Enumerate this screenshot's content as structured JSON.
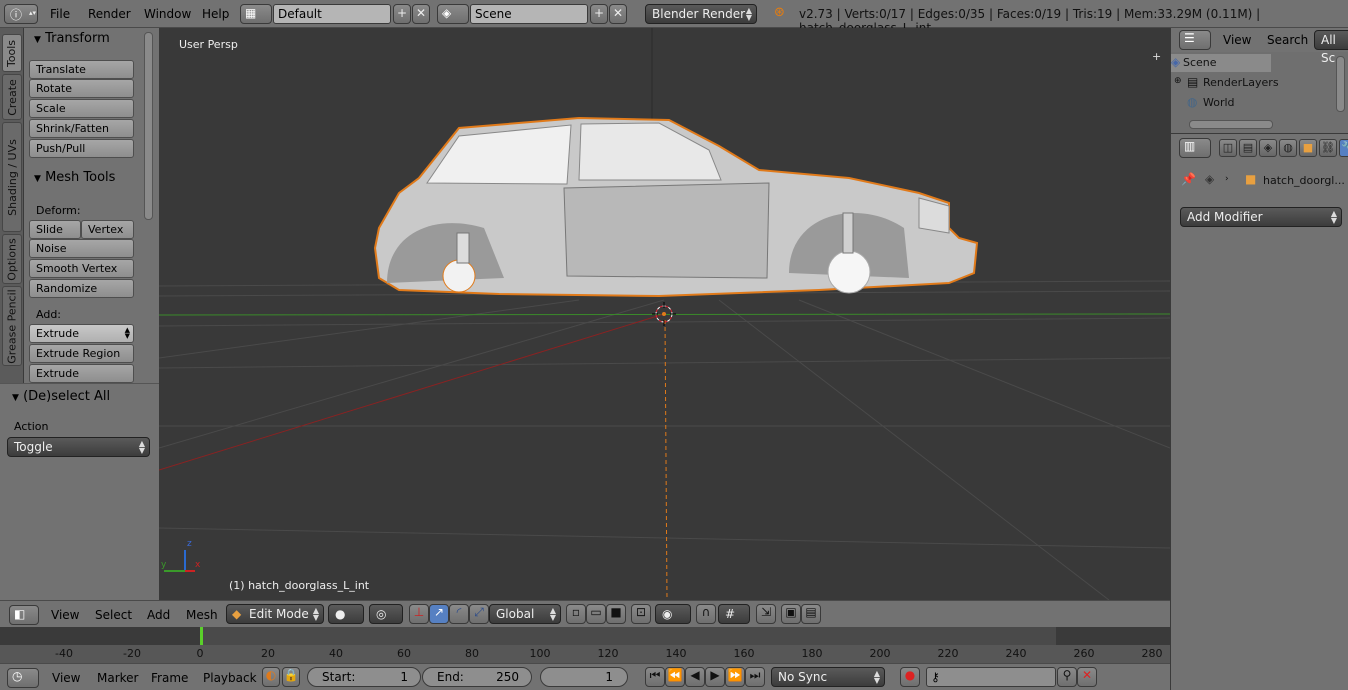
{
  "topbar": {
    "menus": [
      "File",
      "Render",
      "Window",
      "Help"
    ],
    "layout": "Default",
    "scene": "Scene",
    "engine": "Blender Render",
    "stats": "v2.73 | Verts:0/17 | Edges:0/35 | Faces:0/19 | Tris:19 | Mem:33.29M (0.11M) | hatch_doorglass_L_int"
  },
  "toolshelf": {
    "tabs": [
      "Tools",
      "Create",
      "Shading / UVs",
      "Options",
      "Grease Pencil"
    ],
    "transform_title": "Transform",
    "transform_buttons": [
      "Translate",
      "Rotate",
      "Scale",
      "Shrink/Fatten",
      "Push/Pull"
    ],
    "mesh_title": "Mesh Tools",
    "deform_label": "Deform:",
    "slide_edge": "Slide Ed",
    "vertex": "Vertex",
    "noise": "Noise",
    "smooth_vertex": "Smooth Vertex",
    "randomize": "Randomize",
    "add_label": "Add:",
    "extrude": "Extrude",
    "extrude_region": "Extrude Region",
    "extrude_individual": "Extrude Individual"
  },
  "operator": {
    "title": "(De)select All",
    "action_label": "Action",
    "action_value": "Toggle"
  },
  "viewport": {
    "view_label": "User Persp",
    "object_label": "(1) hatch_doorglass_L_int",
    "axis_z": "z",
    "axis_x": "x",
    "axis_y": "y"
  },
  "vp_header": {
    "menus": [
      "View",
      "Select",
      "Add",
      "Mesh"
    ],
    "mode": "Edit Mode",
    "orientation": "Global"
  },
  "timeline": {
    "ticks": [
      "-40",
      "-20",
      "0",
      "20",
      "40",
      "60",
      "80",
      "100",
      "120",
      "140",
      "160",
      "180",
      "200",
      "220",
      "240",
      "260",
      "280"
    ],
    "current_frame_marker": 1
  },
  "tl_header": {
    "menus": [
      "View",
      "Marker",
      "Frame",
      "Playback"
    ],
    "start_label": "Start:",
    "start_value": "1",
    "end_label": "End:",
    "end_value": "250",
    "current_frame": "1",
    "sync": "No Sync"
  },
  "outliner": {
    "menus": [
      "View",
      "Search",
      "All Sc"
    ],
    "items": [
      "Scene",
      "RenderLayers",
      "World"
    ]
  },
  "properties": {
    "object_name": "hatch_doorgl...",
    "add_modifier": "Add Modifier"
  }
}
